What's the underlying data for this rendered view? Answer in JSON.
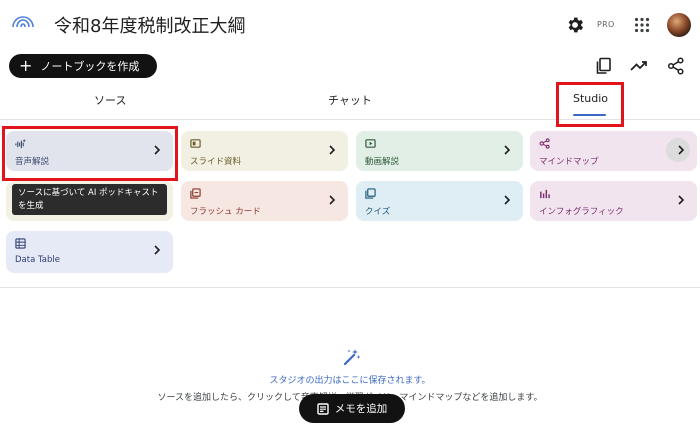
{
  "header": {
    "title": "令和8年度税制改正大綱",
    "pro_badge": "PRO",
    "icons": [
      "notebooklm-logo-icon",
      "gear-icon",
      "apps-grid-icon",
      "avatar"
    ]
  },
  "toolbar": {
    "create_label": "ノートブックを作成",
    "icons": [
      "copy-icon",
      "analytics-icon",
      "share-icon"
    ]
  },
  "tabs": [
    {
      "label": "ソース"
    },
    {
      "label": "チャット"
    },
    {
      "label": "Studio",
      "selected": true
    }
  ],
  "studio_cards": [
    {
      "label": "音声解説",
      "icon": "audio-waveform-icon",
      "bg": "#e1e3ed",
      "fg": "#3c4a6e"
    },
    {
      "label": "スライド資料",
      "icon": "slides-icon",
      "bg": "#f1f0e3",
      "fg": "#6b5a2a"
    },
    {
      "label": "動画解説",
      "icon": "video-icon",
      "bg": "#e2efe6",
      "fg": "#2f5a3c"
    },
    {
      "label": "マインドマップ",
      "icon": "mindmap-icon",
      "bg": "#f1e4ef",
      "fg": "#7b2f6e"
    },
    {
      "label": "",
      "icon": "report-icon",
      "bg": "#f2f1e3",
      "fg": "#6b5a2a"
    },
    {
      "label": "フラッシュ カード",
      "icon": "flashcard-icon",
      "bg": "#f6e7e3",
      "fg": "#8a3a2a"
    },
    {
      "label": "クイズ",
      "icon": "quiz-icon",
      "bg": "#dfedf5",
      "fg": "#1f5a78"
    },
    {
      "label": "インフォグラフィック",
      "icon": "infographic-icon",
      "bg": "#f1e4ef",
      "fg": "#7b2f6e"
    },
    {
      "label": "Data Table",
      "icon": "table-icon",
      "bg": "#e6e9f6",
      "fg": "#2f3f78"
    }
  ],
  "tooltip": {
    "text": "ソースに基づいて AI ポッドキャストを生成"
  },
  "empty_state": {
    "title": "スタジオの出力はここに保存されます。",
    "description": "ソースを追加したら、クリックして音声解説、学習ガイド、マインドマップなどを追加します。"
  },
  "memo_button": {
    "label": "メモを追加"
  },
  "colors": {
    "accent": "#3b68c7",
    "highlight_box": "#e1141b",
    "dark_button": "#121212"
  }
}
